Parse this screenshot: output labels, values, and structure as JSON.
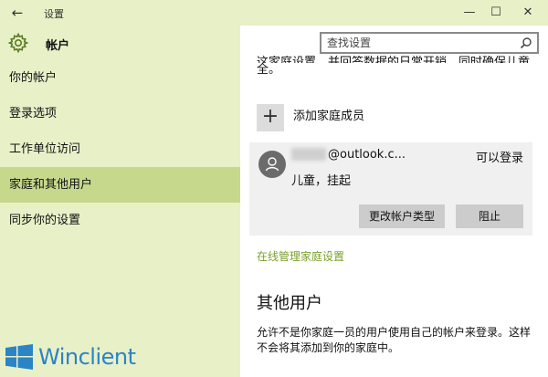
{
  "window": {
    "title": "设置",
    "back_glyph": "←",
    "minimize_glyph": "—",
    "maximize_glyph": "☐",
    "close_glyph": "✕"
  },
  "app": {
    "title": "帐户"
  },
  "search": {
    "placeholder": "查找设置"
  },
  "sidebar": {
    "items": [
      {
        "label": "你的帐户",
        "active": false
      },
      {
        "label": "登录选项",
        "active": false
      },
      {
        "label": "工作单位访问",
        "active": false
      },
      {
        "label": "家庭和其他用户",
        "active": true
      },
      {
        "label": "同步你的设置",
        "active": false
      }
    ]
  },
  "main": {
    "cut_text": "这家庭设置，并回答数据的日常开销，同时确保儿童们的安",
    "cut_text_2": "全。",
    "add_member": {
      "glyph": "+",
      "label": "添加家庭成员"
    },
    "member": {
      "email": "@outlook.c...",
      "status": "可以登录",
      "role": "儿童，挂起",
      "change_type_label": "更改帐户类型",
      "block_label": "阻止"
    },
    "manage_link": "在线管理家庭设置",
    "other_users": {
      "title": "其他用户",
      "description": "允许不是你家庭一员的用户使用自己的帐户来登录。这样不会将其添加到你的家庭中。"
    }
  },
  "watermark": {
    "brand": "Winclient"
  },
  "colors": {
    "sidebar_bg": "#e8f0c8",
    "active_bg": "#c5d88c",
    "link": "#7aa02a",
    "brand": "#2b84c6"
  }
}
